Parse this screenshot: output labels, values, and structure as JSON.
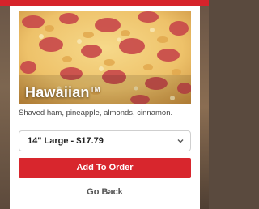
{
  "product": {
    "name": "Hawaiian",
    "trademark": "TM",
    "description": "Shaved ham, pineapple, almonds, cinnamon.",
    "image_icon": "pizza-photo"
  },
  "size_select": {
    "selected": "14\" Large - $17.79",
    "icon": "chevron-down-icon"
  },
  "actions": {
    "add_label": "Add To Order",
    "back_label": "Go Back"
  },
  "colors": {
    "brand_red": "#d8262d",
    "top_bar": "#d6232b",
    "text_muted": "#555555"
  }
}
